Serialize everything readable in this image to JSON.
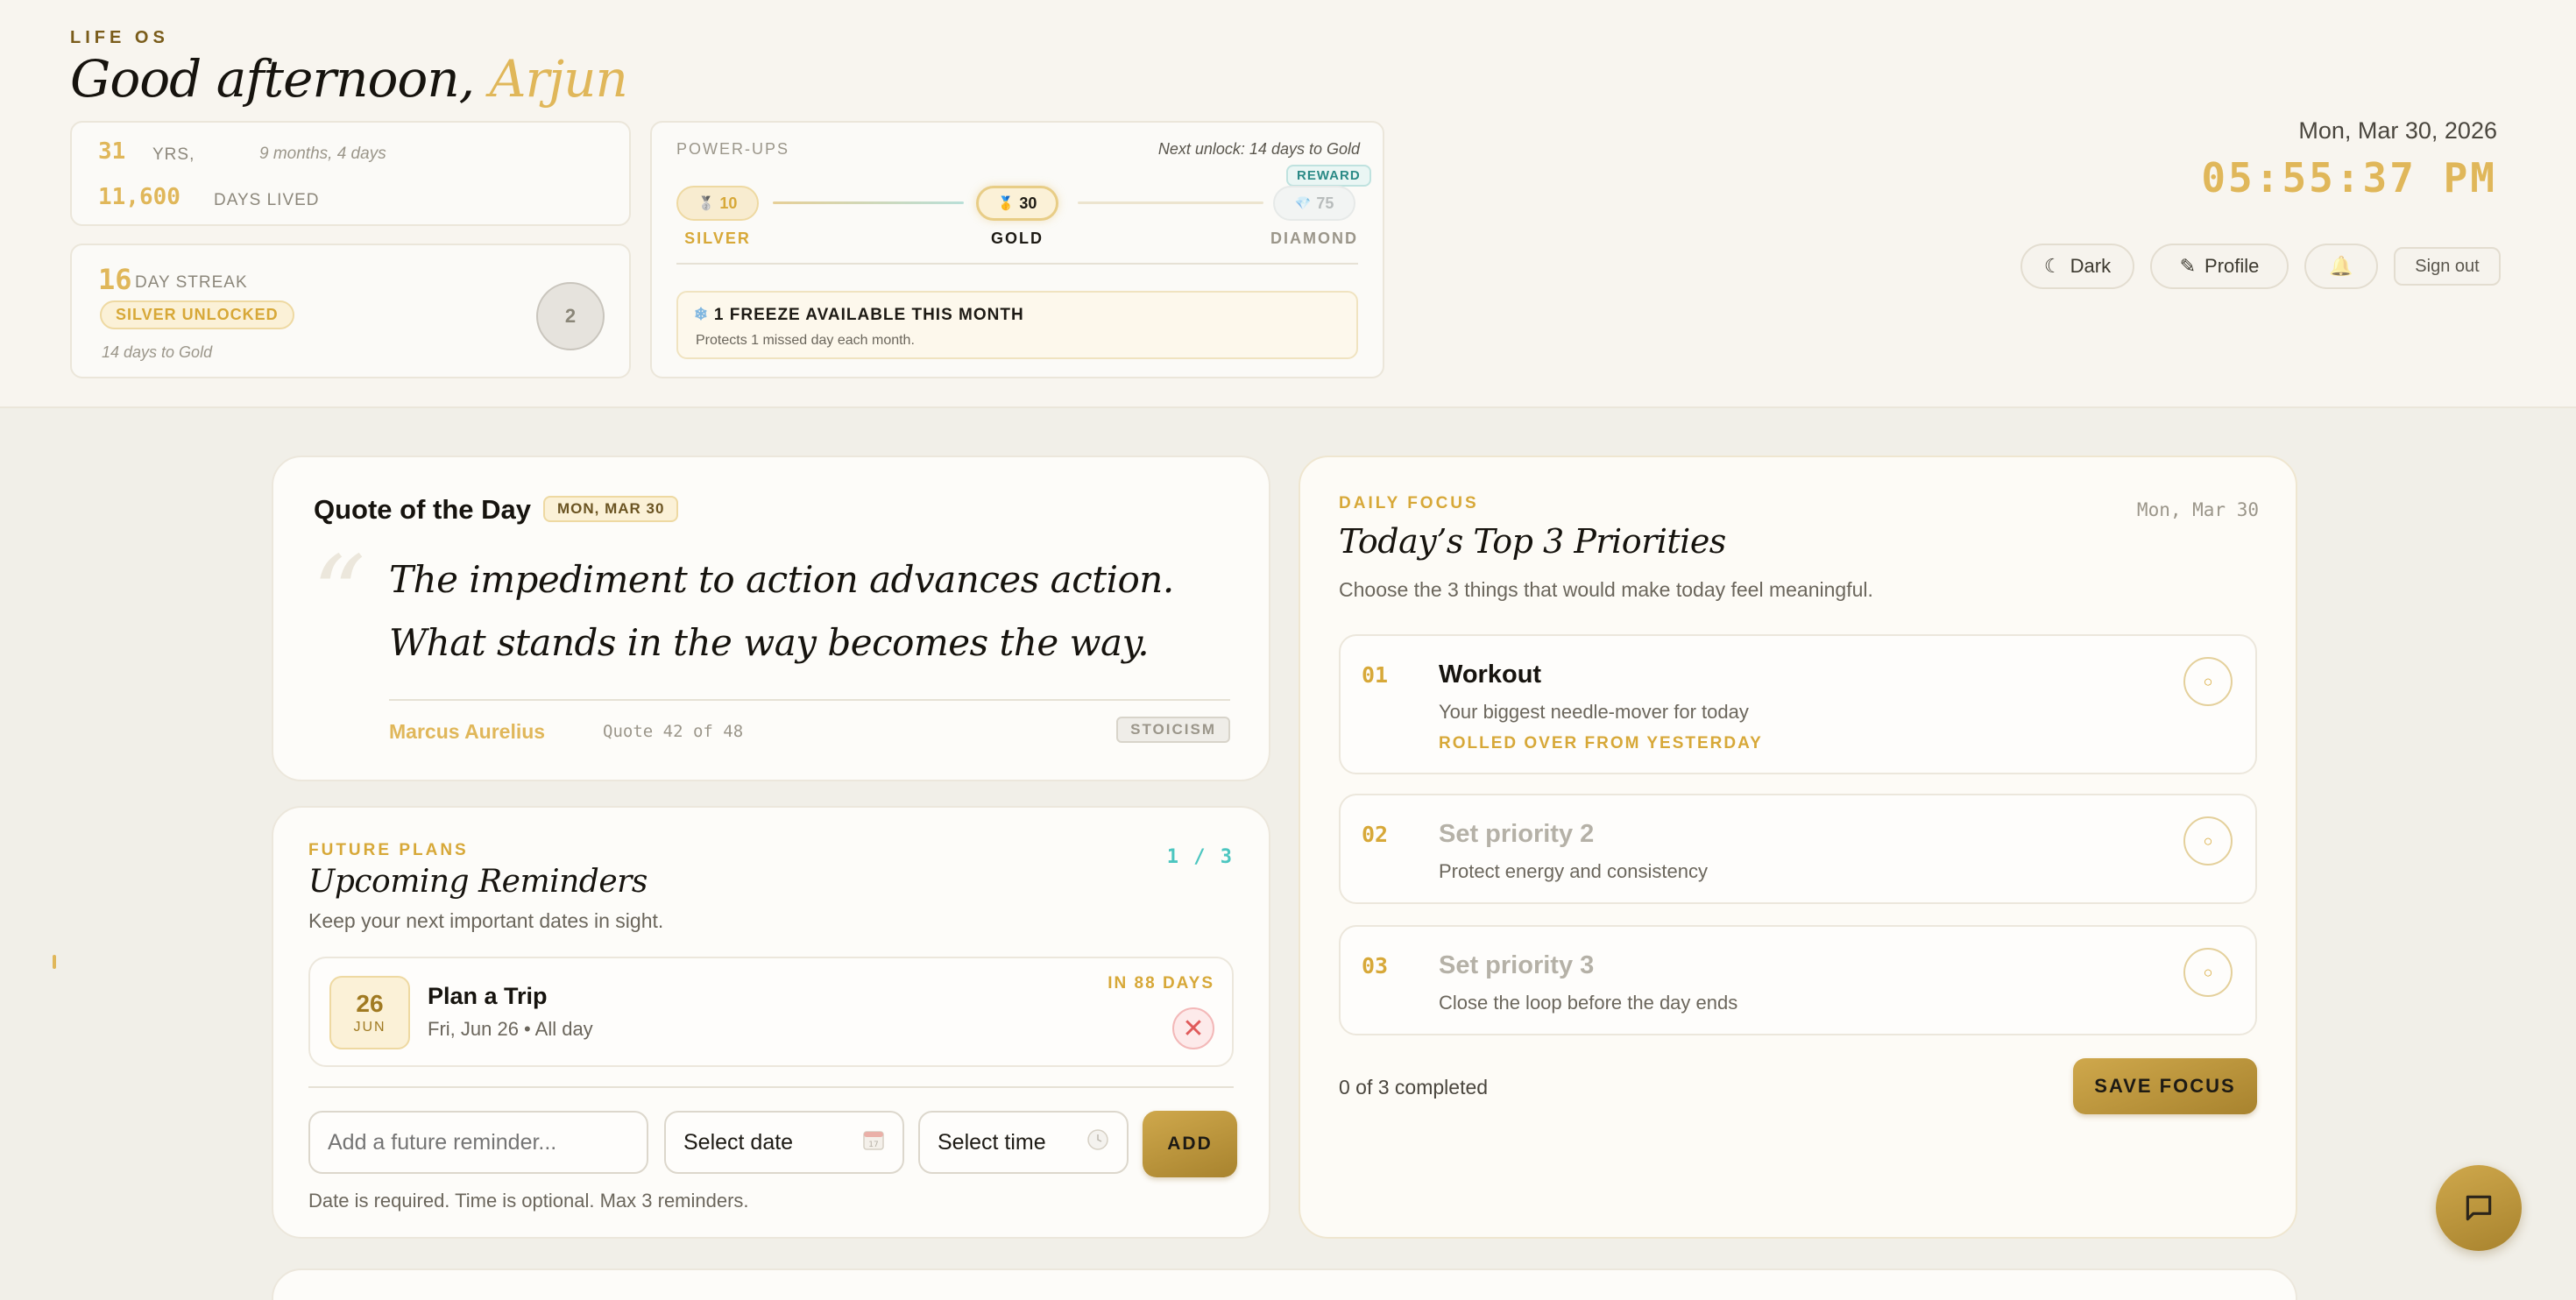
{
  "header": {
    "app_label": "LIFE OS",
    "greeting_prefix": "Good afternoon,",
    "user_name": "Arjun"
  },
  "age": {
    "years": "31",
    "years_unit": "YRS,",
    "rest": "9 months, 4 days",
    "days": "11,600",
    "days_unit": "DAYS LIVED"
  },
  "streak": {
    "count": "16",
    "unit": "DAY STREAK",
    "badge": "SILVER UNLOCKED",
    "hint": "14 days to Gold",
    "medal_glyph": "2"
  },
  "power_ups": {
    "label": "POWER-UPS",
    "next_unlock": "Next unlock: 14 days to Gold",
    "tiers": [
      {
        "icon": "🥈",
        "value": "10",
        "name": "SILVER"
      },
      {
        "icon": "🥇",
        "value": "30",
        "name": "GOLD"
      },
      {
        "icon": "💎",
        "value": "75",
        "name": "DIAMOND"
      }
    ],
    "reward_tag": "REWARD",
    "freeze_icon": "❄",
    "freeze_title": "1 FREEZE AVAILABLE THIS MONTH",
    "freeze_sub": "Protects 1 missed day each month."
  },
  "clock": {
    "date": "Mon, Mar 30, 2026",
    "time": "05:55:37 PM"
  },
  "actions": {
    "dark": "Dark",
    "dark_icon": "☾",
    "profile": "Profile",
    "profile_icon": "✎",
    "bell_icon": "🔔",
    "signout": "Sign out"
  },
  "quote": {
    "title": "Quote of the Day",
    "date_tag": "MON, MAR 30",
    "mark": "“",
    "text": "The impediment to action advances action. What stands in the way becomes the way.",
    "author": "Marcus Aurelius",
    "counter": "Quote 42 of 48",
    "tag": "STOICISM"
  },
  "future_plans": {
    "label": "FUTURE PLANS",
    "title": "Upcoming Reminders",
    "subtitle": "Keep your next important dates in sight.",
    "counter": "1 / 3",
    "reminders": [
      {
        "day": "26",
        "month": "JUN",
        "title": "Plan a Trip",
        "meta": "Fri, Jun 26 • All day",
        "in_days": "IN 88 DAYS"
      }
    ],
    "input_placeholder": "Add a future reminder...",
    "date_value": "Select date",
    "time_value": "Select time",
    "add_label": "ADD",
    "note": "Date is required. Time is optional. Max 3 reminders."
  },
  "daily_focus": {
    "label": "DAILY FOCUS",
    "date": "Mon, Mar 30",
    "title": "Today’s Top 3 Priorities",
    "subtitle": "Choose the 3 things that would make today feel meaningful.",
    "priorities": [
      {
        "num": "01",
        "title": "Workout",
        "sub": "Your biggest needle-mover for today",
        "note": "ROLLED OVER FROM YESTERDAY"
      },
      {
        "num": "02",
        "title": "Set priority 2",
        "sub": "Protect energy and consistency"
      },
      {
        "num": "03",
        "title": "Set priority 3",
        "sub": "Close the loop before the day ends"
      }
    ],
    "check_glyph": "○",
    "progress": "0 of 3 completed",
    "save_label": "SAVE FOCUS"
  },
  "colors": {
    "accent_gold": "#e0b75a",
    "button_gold": "#b8923a",
    "teal": "#4cc6c0",
    "background": "#f1efe8"
  }
}
